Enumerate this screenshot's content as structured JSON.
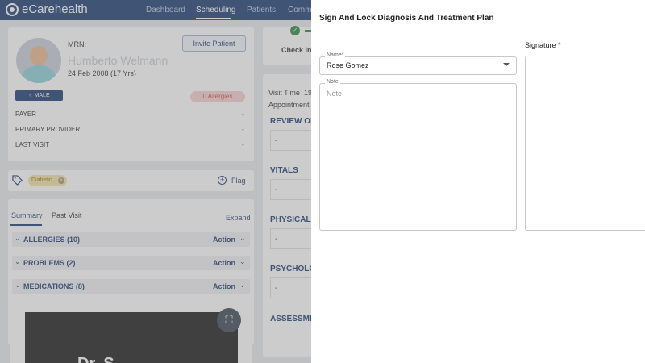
{
  "nav": {
    "brand": "eCarehealth",
    "items": [
      "Dashboard",
      "Scheduling",
      "Patients",
      "Commu"
    ],
    "active": "Scheduling"
  },
  "patient": {
    "mrn_label": "MRN:",
    "name": "Humberto Welmann",
    "dob": "24 Feb 2008 (17 Yrs)",
    "invite_label": "Invite Patient",
    "gender": "♂ MALE",
    "allergies_badge": "0 Allergies",
    "info": [
      {
        "label": "PAYER",
        "value": "-"
      },
      {
        "label": "PRIMARY PROVIDER",
        "value": "-"
      },
      {
        "label": "LAST VISIT",
        "value": "-"
      }
    ],
    "tag": "Diabetic",
    "flag_label": "Flag"
  },
  "summary": {
    "tabs": [
      "Summary",
      "Past Visit"
    ],
    "expand_label": "Expand",
    "sections": [
      {
        "label": "ALLERGIES (10)",
        "action": "Action"
      },
      {
        "label": "PROBLEMS (2)",
        "action": "Action"
      },
      {
        "label": "MEDICATIONS (8)",
        "action": "Action"
      }
    ],
    "video_text": "Dr. S..."
  },
  "visit": {
    "checkin_label": "Check In",
    "visit_time_label": "Visit Time",
    "visit_time_value": "19",
    "appointment_label": "Appointment",
    "sections": [
      "REVIEW OF",
      "VITALS",
      "PHYSICAL E",
      "PSYCHOLO",
      "ASSESSME"
    ],
    "dash": "-"
  },
  "modal": {
    "title": "Sign And Lock Diagnosis And Treatment Plan",
    "name_label": "Name",
    "name_value": "Rose Gomez",
    "note_label": "Note",
    "note_placeholder": "Note",
    "signature_label": "Signature",
    "required_mark": "*"
  },
  "colors": {
    "primary": "#1e3f73",
    "allergy_text": "#d84848",
    "success": "#2e8b3e",
    "tag_bg": "#f4e3a8"
  }
}
